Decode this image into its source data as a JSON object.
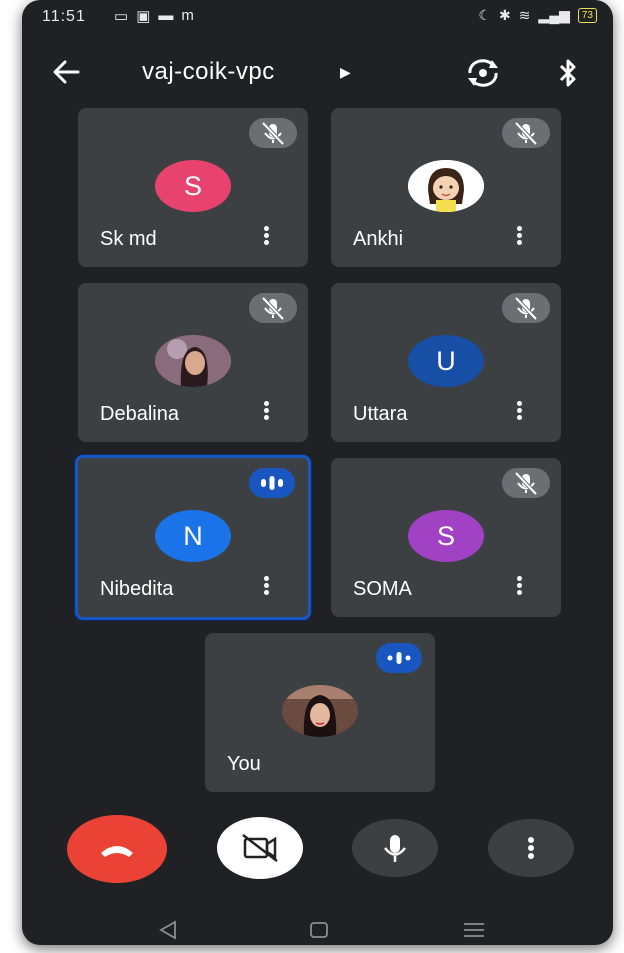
{
  "status": {
    "time": "11:51",
    "battery": "73"
  },
  "header": {
    "meeting_code": "vaj-coik-vpc"
  },
  "participants": [
    {
      "name": "Sk md",
      "initial": "S",
      "color": "#e8436e",
      "mic": "muted"
    },
    {
      "name": "Ankhi",
      "initial": "",
      "color": "#ffffff",
      "mic": "muted"
    },
    {
      "name": "Debalina",
      "initial": "",
      "color": "#7a5a6a",
      "mic": "muted"
    },
    {
      "name": "Uttara",
      "initial": "U",
      "color": "#174ea6",
      "mic": "muted"
    },
    {
      "name": "Nibedita",
      "initial": "N",
      "color": "#1a73e8",
      "mic": "speaking"
    },
    {
      "name": "SOMA",
      "initial": "S",
      "color": "#a142c4",
      "mic": "muted"
    },
    {
      "name": "You",
      "initial": "",
      "color": "#5a3a3a",
      "mic": "speaking"
    }
  ],
  "colors": {
    "background": "#202124",
    "tile": "#3c4043",
    "end_call": "#ea4335",
    "active_border": "#1a56c0"
  }
}
